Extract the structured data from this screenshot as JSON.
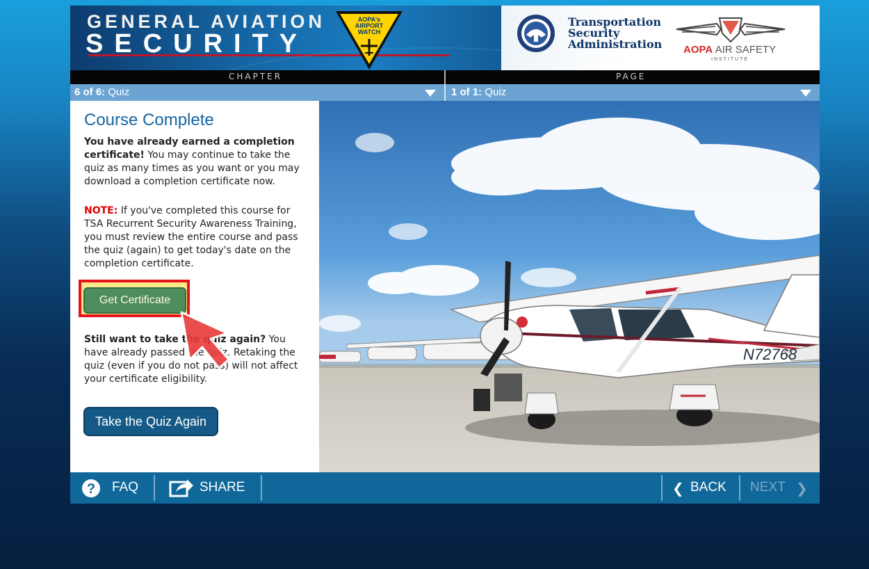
{
  "header": {
    "title_line1": "GENERAL AVIATION",
    "title_line2": "SECURITY",
    "badge": {
      "line1": "AOPA's",
      "line2": "AIRPORT",
      "line3": "WATCH"
    },
    "tsa": {
      "line1": "Transportation",
      "line2": "Security",
      "line3": "Administration"
    },
    "aopa": {
      "brand": "AOPA",
      "name": " AIR SAFETY",
      "sub": "INSTITUTE"
    }
  },
  "nav": {
    "chapter_label": "CHAPTER",
    "page_label": "PAGE",
    "chapter_select": {
      "num": "6 of 6:",
      "name": " Quiz"
    },
    "page_select": {
      "num": "1 of 1:",
      "name": " Quiz"
    }
  },
  "content": {
    "title": "Course Complete",
    "intro_bold": "You have already earned a completion certificate!",
    "intro_rest": " You may continue to take the quiz as many times as you want or you may download a completion certificate now.",
    "note_label": "NOTE:",
    "note_text": " If you've completed this course for TSA Recurrent Security Awareness Training, you must review the entire course and pass the quiz (again) to get today's date on the completion certificate.",
    "get_cert_label": "Get Certificate",
    "retake_bold": "Still want to take the quiz again?",
    "retake_text": " You have already passed the quiz. Retaking the quiz (even if you do not pass) will not affect your certificate eligibility.",
    "retake_button": "Take the Quiz Again"
  },
  "photo": {
    "tail_number": "N72768"
  },
  "footer": {
    "faq": "FAQ",
    "share": "SHARE",
    "back": "BACK",
    "next": "NEXT"
  },
  "colors": {
    "nav_blue": "#6ba4d3",
    "footer_blue": "#10679a",
    "title_blue": "#1565a3",
    "cert_green": "#4e8d5c",
    "retake_blue": "#155a86",
    "highlight_red": "#e5141a",
    "next_disabled": "#7fa8c6"
  }
}
